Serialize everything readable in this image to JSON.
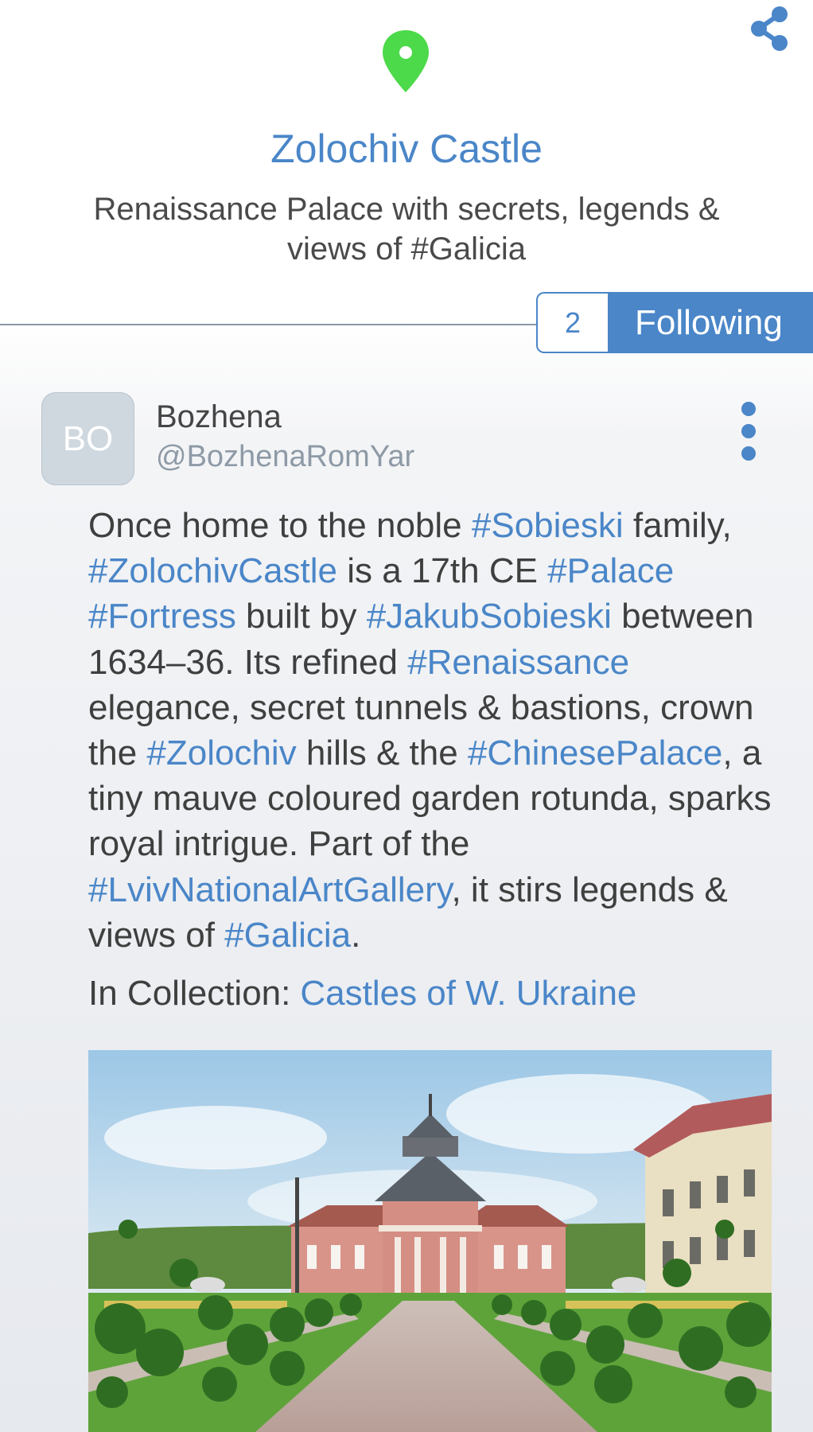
{
  "header": {
    "title": "Zolochiv Castle",
    "subtitle": "Renaissance Palace with secrets, legends & views of #Galicia",
    "pin_color": "#4cd94a",
    "accent_color": "#4a86c8",
    "share_icon": "share-icon",
    "location_icon": "map-pin-icon"
  },
  "follow": {
    "count": "2",
    "label": "Following"
  },
  "post": {
    "author": {
      "initials": "BO",
      "name": "Bozhena",
      "handle": "@BozhenaRomYar"
    },
    "more_icon": "more-vertical-icon",
    "body": [
      {
        "text": "Once home to the noble ",
        "tag": false
      },
      {
        "text": "#Sobieski",
        "tag": true
      },
      {
        "text": " family, ",
        "tag": false
      },
      {
        "text": "#ZolochivCastle",
        "tag": true
      },
      {
        "text": " is a 17th CE ",
        "tag": false
      },
      {
        "text": "#Palace",
        "tag": true
      },
      {
        "text": " ",
        "tag": false
      },
      {
        "text": "#Fortress",
        "tag": true
      },
      {
        "text": " built by ",
        "tag": false
      },
      {
        "text": "#JakubSobieski",
        "tag": true
      },
      {
        "text": " between 1634–36. Its refined ",
        "tag": false
      },
      {
        "text": "#Renaissance",
        "tag": true
      },
      {
        "text": " elegance, secret tunnels & bastions, crown the ",
        "tag": false
      },
      {
        "text": "#Zolochiv",
        "tag": true
      },
      {
        "text": " hills & the ",
        "tag": false
      },
      {
        "text": "#ChinesePalace",
        "tag": true
      },
      {
        "text": ", a tiny mauve coloured garden rotunda, sparks royal intrigue. Part of the ",
        "tag": false
      },
      {
        "text": "#LvivNationalArtGallery",
        "tag": true
      },
      {
        "text": ", it stirs legends & views of ",
        "tag": false
      },
      {
        "text": "#Galicia",
        "tag": true
      },
      {
        "text": ".",
        "tag": false
      }
    ],
    "collection_label": "In Collection:",
    "collection_link": "Castles of W. Ukraine"
  }
}
